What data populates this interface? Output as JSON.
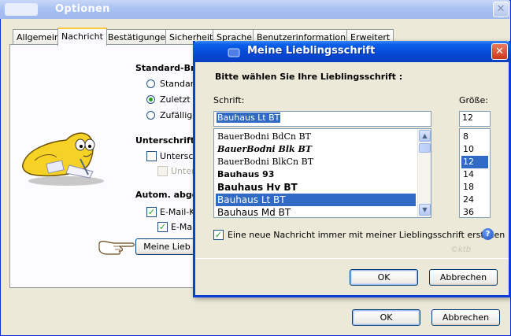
{
  "outer": {
    "title": "Optionen",
    "tabs": [
      "Allgemein",
      "Nachricht",
      "Bestätigungen",
      "Sicherheit",
      "Sprache",
      "Benutzerinformationen",
      "Erweitert"
    ],
    "standard": {
      "title": "Standard-Brie",
      "options": [
        "Standard",
        "Zuletzt v",
        "Zufällige"
      ]
    },
    "signature": {
      "title": "Unterschrift",
      "opt1": "Untersch",
      "opt2": "Unter"
    },
    "autosave": {
      "title": "Autom. abges",
      "opt1": "E-Mail-K",
      "opt2": "E-Ma"
    },
    "favorite_font_button": "Meine Lieb",
    "ok_label": "OK",
    "cancel_label": "Abbrechen"
  },
  "inner": {
    "title": "Meine Lieblingsschrift",
    "instruction": "Bitte wählen Sie Ihre Lieblingsschrift :",
    "font_label": "Schrift:",
    "size_label": "Größe:",
    "font_value": "Bauhaus Lt BT",
    "size_value": "12",
    "fonts": [
      "BauerBodni BdCn BT",
      "BauerBodni Blk BT",
      "BauerBodni BlkCn BT",
      "Bauhaus 93",
      "Bauhaus Hv BT",
      "Bauhaus Lt BT",
      "Bauhaus Md BT"
    ],
    "selected_font_index": 5,
    "sizes": [
      "8",
      "10",
      "12",
      "14",
      "18",
      "24",
      "36"
    ],
    "selected_size_index": 2,
    "checkbox_label": "Eine neue Nachricht immer mit meiner Lieblingsschrift erstellen",
    "watermark": "©ktb",
    "help": "?",
    "ok_label": "OK",
    "cancel_label": "Abbrechen"
  },
  "icons": {
    "close": "close-icon",
    "help": "help-icon",
    "pointer": "pointing-hand-icon",
    "mascot": "mascot-image"
  },
  "colors": {
    "inner_title_bar": "#0549d6",
    "selection": "#316ac5",
    "check": "#21a121"
  }
}
